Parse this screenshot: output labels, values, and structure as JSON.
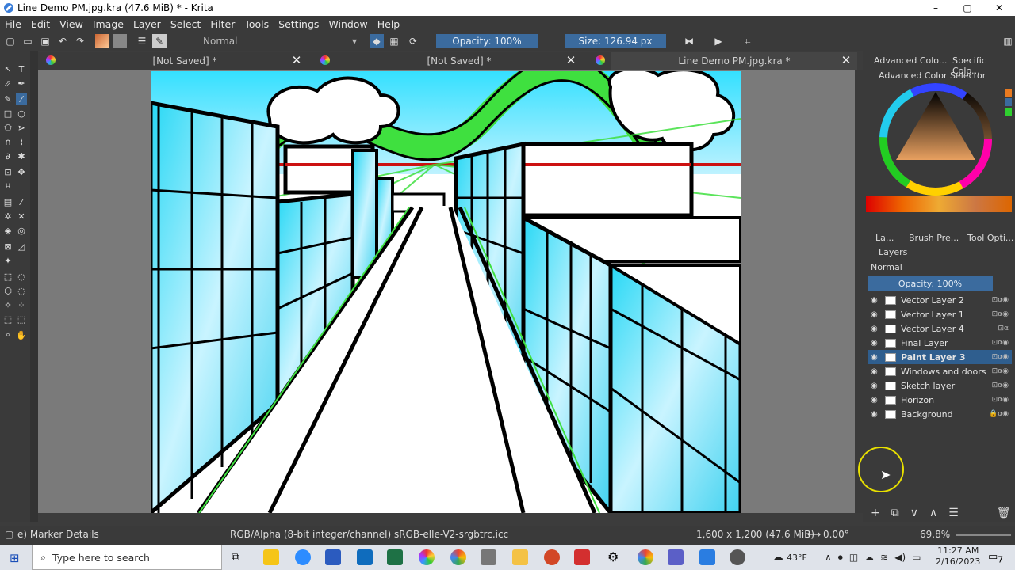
{
  "window": {
    "title": "Line Demo PM.jpg.kra (47.6 MiB)  * - Krita",
    "minimize": "–",
    "maximize": "▢",
    "close": "✕"
  },
  "menu": [
    "File",
    "Edit",
    "View",
    "Image",
    "Layer",
    "Select",
    "Filter",
    "Tools",
    "Settings",
    "Window",
    "Help"
  ],
  "toolbar": {
    "blend_mode": "Normal",
    "opacity": "Opacity: 100%",
    "size": "Size: 126.94 px"
  },
  "tabs": [
    {
      "label": "[Not Saved]  *"
    },
    {
      "label": "[Not Saved]  *"
    },
    {
      "label": "Line Demo PM.jpg.kra  *"
    }
  ],
  "right_panel": {
    "top_tabs": [
      "Advanced Colo...",
      "Specific Colo..."
    ],
    "color_selector_title": "Advanced Color Selector",
    "mid_tabs": [
      "La...",
      "Brush Pre...",
      "Tool Opti..."
    ],
    "layers_title": "Layers",
    "blend": "Normal",
    "opacity": "Opacity:  100%",
    "layers": [
      {
        "name": "Vector Layer 2",
        "active": false
      },
      {
        "name": "Vector Layer 1",
        "active": false
      },
      {
        "name": "Vector Layer 4",
        "active": false
      },
      {
        "name": "Final Layer",
        "active": false
      },
      {
        "name": "Paint Layer 3",
        "active": true
      },
      {
        "name": "Windows and doors",
        "active": false
      },
      {
        "name": "Sketch layer",
        "active": false
      },
      {
        "name": "Horizon",
        "active": false
      },
      {
        "name": "Background",
        "active": false
      }
    ]
  },
  "status": {
    "brush": "e) Marker Details",
    "colorspace": "RGB/Alpha (8-bit integer/channel)  sRGB-elle-V2-srgbtrc.icc",
    "size": "1,600 x 1,200 (47.6 MiB)",
    "rotation": "0.00°",
    "zoom": "69.8%"
  },
  "taskbar": {
    "search_placeholder": "Type here to search",
    "weather": "43°F",
    "time": "11:27 AM",
    "date": "2/16/2023",
    "notifications": "7"
  }
}
